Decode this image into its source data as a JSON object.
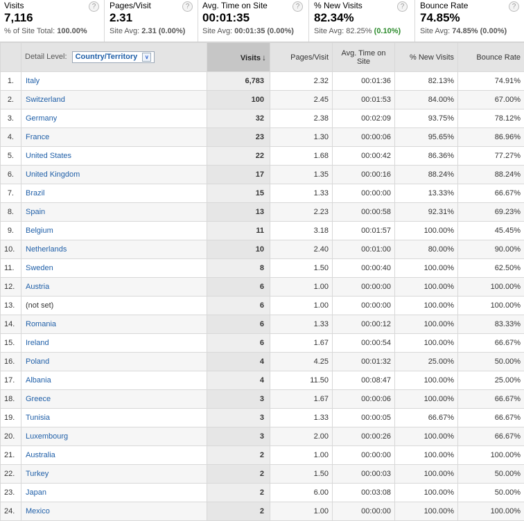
{
  "summary": {
    "visits": {
      "label": "Visits",
      "value": "7,116",
      "sub_prefix": "% of Site Total:",
      "sub_value": "100.00%"
    },
    "pages_visit": {
      "label": "Pages/Visit",
      "value": "2.31",
      "sub_prefix": "Site Avg:",
      "sub_value": "2.31 (0.00%)"
    },
    "avg_time": {
      "label": "Avg. Time on Site",
      "value": "00:01:35",
      "sub_prefix": "Site Avg:",
      "sub_value": "00:01:35 (0.00%)"
    },
    "new_visits": {
      "label": "% New Visits",
      "value": "82.34%",
      "sub_prefix": "Site Avg: 82.25%",
      "sub_value": "(0.10%)"
    },
    "bounce_rate": {
      "label": "Bounce Rate",
      "value": "74.85%",
      "sub_prefix": "Site Avg:",
      "sub_value": "74.85% (0.00%)"
    },
    "help_glyph": "?"
  },
  "table": {
    "detail_level_label": "Detail Level:",
    "detail_level_value": "Country/Territory",
    "columns": {
      "visits": "Visits",
      "pages_visit": "Pages/Visit",
      "avg_time": "Avg. Time on Site",
      "new_visits": "% New Visits",
      "bounce_rate": "Bounce Rate"
    },
    "sort_arrow": "↓",
    "rows": [
      {
        "idx": "1.",
        "country": "Italy",
        "visits": "6,783",
        "pv": "2.32",
        "time": "00:01:36",
        "new": "82.13%",
        "bounce": "74.91%"
      },
      {
        "idx": "2.",
        "country": "Switzerland",
        "visits": "100",
        "pv": "2.45",
        "time": "00:01:53",
        "new": "84.00%",
        "bounce": "67.00%"
      },
      {
        "idx": "3.",
        "country": "Germany",
        "visits": "32",
        "pv": "2.38",
        "time": "00:02:09",
        "new": "93.75%",
        "bounce": "78.12%"
      },
      {
        "idx": "4.",
        "country": "France",
        "visits": "23",
        "pv": "1.30",
        "time": "00:00:06",
        "new": "95.65%",
        "bounce": "86.96%"
      },
      {
        "idx": "5.",
        "country": "United States",
        "visits": "22",
        "pv": "1.68",
        "time": "00:00:42",
        "new": "86.36%",
        "bounce": "77.27%"
      },
      {
        "idx": "6.",
        "country": "United Kingdom",
        "visits": "17",
        "pv": "1.35",
        "time": "00:00:16",
        "new": "88.24%",
        "bounce": "88.24%"
      },
      {
        "idx": "7.",
        "country": "Brazil",
        "visits": "15",
        "pv": "1.33",
        "time": "00:00:00",
        "new": "13.33%",
        "bounce": "66.67%"
      },
      {
        "idx": "8.",
        "country": "Spain",
        "visits": "13",
        "pv": "2.23",
        "time": "00:00:58",
        "new": "92.31%",
        "bounce": "69.23%"
      },
      {
        "idx": "9.",
        "country": "Belgium",
        "visits": "11",
        "pv": "3.18",
        "time": "00:01:57",
        "new": "100.00%",
        "bounce": "45.45%"
      },
      {
        "idx": "10.",
        "country": "Netherlands",
        "visits": "10",
        "pv": "2.40",
        "time": "00:01:00",
        "new": "80.00%",
        "bounce": "90.00%"
      },
      {
        "idx": "11.",
        "country": "Sweden",
        "visits": "8",
        "pv": "1.50",
        "time": "00:00:40",
        "new": "100.00%",
        "bounce": "62.50%"
      },
      {
        "idx": "12.",
        "country": "Austria",
        "visits": "6",
        "pv": "1.00",
        "time": "00:00:00",
        "new": "100.00%",
        "bounce": "100.00%"
      },
      {
        "idx": "13.",
        "country": "(not set)",
        "visits": "6",
        "pv": "1.00",
        "time": "00:00:00",
        "new": "100.00%",
        "bounce": "100.00%",
        "plain": true
      },
      {
        "idx": "14.",
        "country": "Romania",
        "visits": "6",
        "pv": "1.33",
        "time": "00:00:12",
        "new": "100.00%",
        "bounce": "83.33%"
      },
      {
        "idx": "15.",
        "country": "Ireland",
        "visits": "6",
        "pv": "1.67",
        "time": "00:00:54",
        "new": "100.00%",
        "bounce": "66.67%"
      },
      {
        "idx": "16.",
        "country": "Poland",
        "visits": "4",
        "pv": "4.25",
        "time": "00:01:32",
        "new": "25.00%",
        "bounce": "50.00%"
      },
      {
        "idx": "17.",
        "country": "Albania",
        "visits": "4",
        "pv": "11.50",
        "time": "00:08:47",
        "new": "100.00%",
        "bounce": "25.00%"
      },
      {
        "idx": "18.",
        "country": "Greece",
        "visits": "3",
        "pv": "1.67",
        "time": "00:00:06",
        "new": "100.00%",
        "bounce": "66.67%"
      },
      {
        "idx": "19.",
        "country": "Tunisia",
        "visits": "3",
        "pv": "1.33",
        "time": "00:00:05",
        "new": "66.67%",
        "bounce": "66.67%"
      },
      {
        "idx": "20.",
        "country": "Luxembourg",
        "visits": "3",
        "pv": "2.00",
        "time": "00:00:26",
        "new": "100.00%",
        "bounce": "66.67%"
      },
      {
        "idx": "21.",
        "country": "Australia",
        "visits": "2",
        "pv": "1.00",
        "time": "00:00:00",
        "new": "100.00%",
        "bounce": "100.00%"
      },
      {
        "idx": "22.",
        "country": "Turkey",
        "visits": "2",
        "pv": "1.50",
        "time": "00:00:03",
        "new": "100.00%",
        "bounce": "50.00%"
      },
      {
        "idx": "23.",
        "country": "Japan",
        "visits": "2",
        "pv": "6.00",
        "time": "00:03:08",
        "new": "100.00%",
        "bounce": "50.00%"
      },
      {
        "idx": "24.",
        "country": "Mexico",
        "visits": "2",
        "pv": "1.00",
        "time": "00:00:00",
        "new": "100.00%",
        "bounce": "100.00%"
      }
    ]
  }
}
